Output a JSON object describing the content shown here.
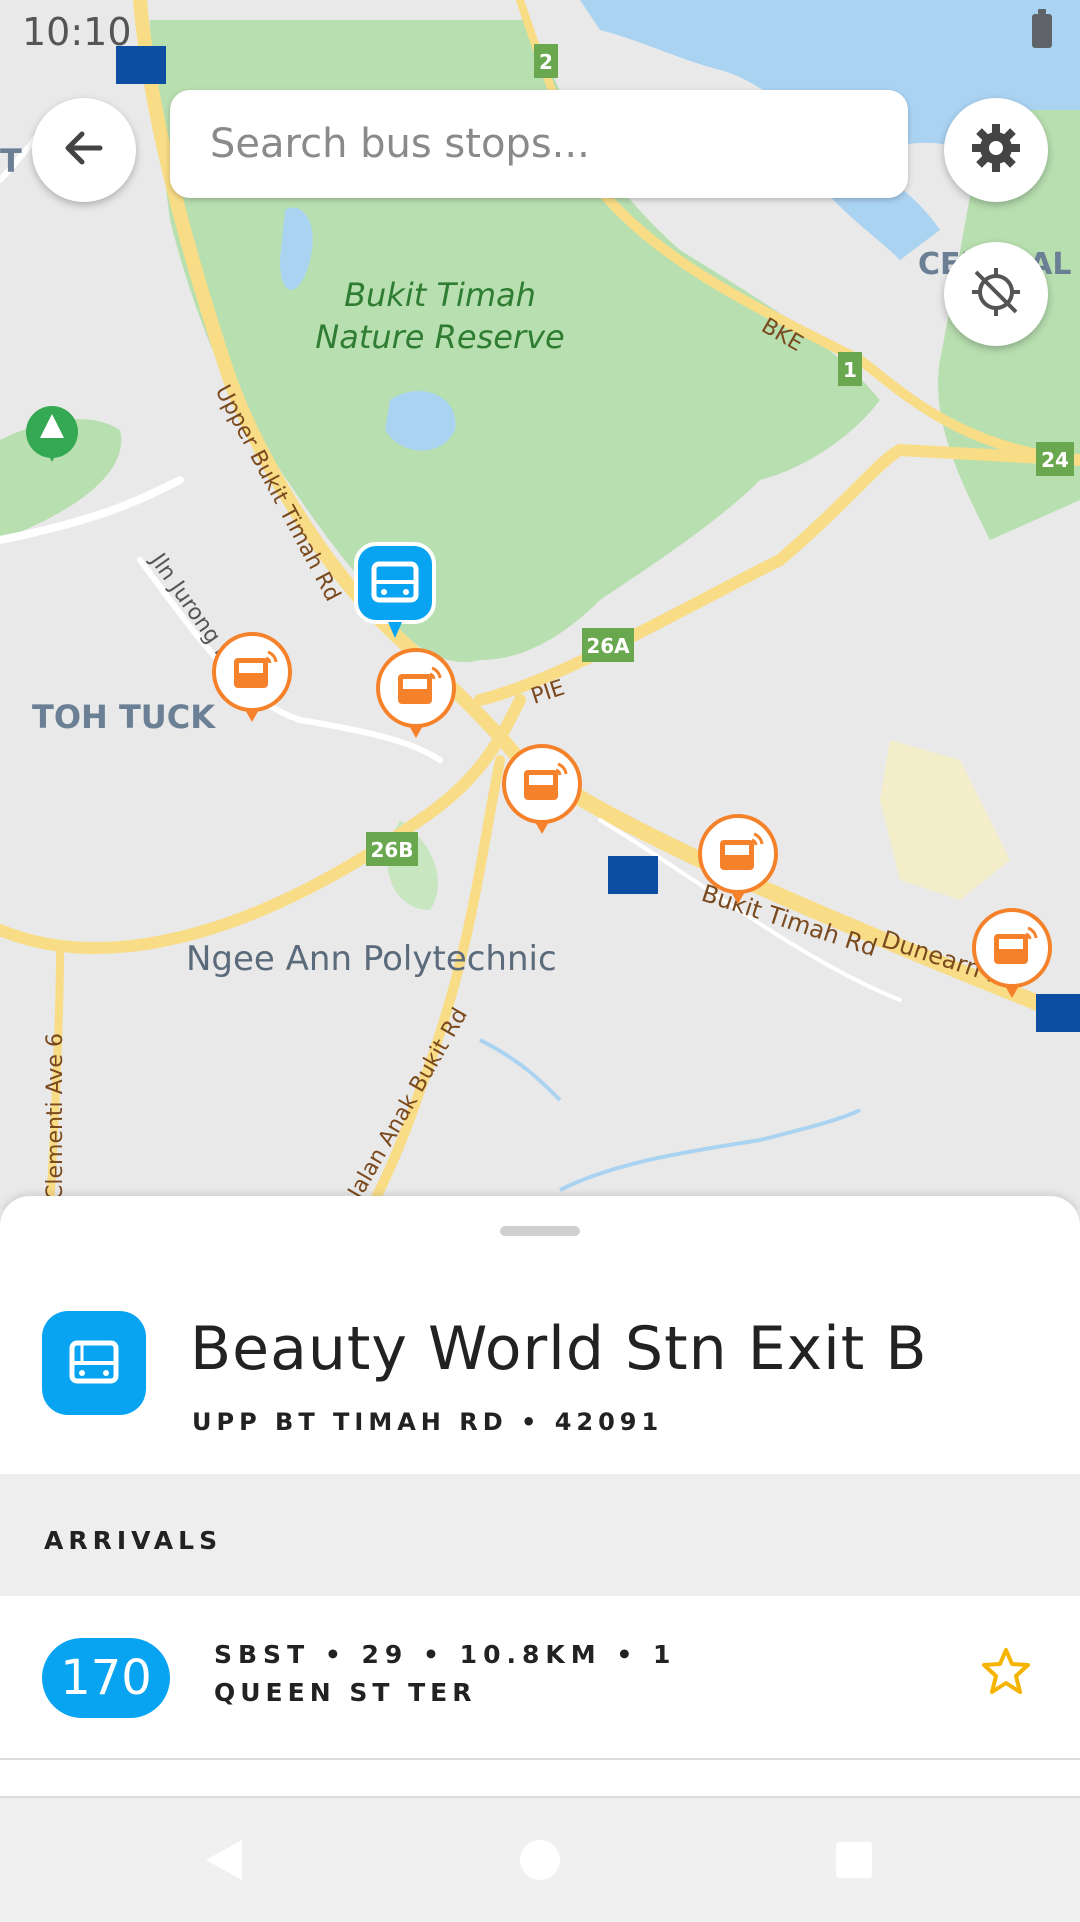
{
  "status_bar": {
    "time": "10:10"
  },
  "search": {
    "placeholder": "Search bus stops..."
  },
  "map_labels": {
    "park": "Bukit Timah Nature Reserve",
    "park_line1": "Bukit Timah",
    "park_line2": "Nature Reserve",
    "area_toh_tuck": "TOH TUCK",
    "area_ngee_ann": "Ngee Ann Polytechnic",
    "area_central": "CENTRAL",
    "area_left": "T",
    "road_upper_bukit_timah": "Upper Bukit Timah Rd",
    "road_jln_jurong": "Jln Jurong Kechil",
    "road_bukit_timah": "Bukit Timah Rd",
    "road_dunearn": "Dunearn Rd",
    "road_pie": "PIE",
    "road_bke": "BKE",
    "road_clementi": "Clementi Ave 6",
    "road_bottom": "Jalan Anak Bukit Rd",
    "exits": [
      "2",
      "1",
      "24",
      "26A",
      "26B"
    ]
  },
  "stop": {
    "name": "Beauty World Stn Exit B",
    "road": "UPP BT TIMAH RD",
    "code": "42091",
    "subtitle": "UPP BT TIMAH RD • 42091"
  },
  "arrivals": {
    "title": "ARRIVALS",
    "items": [
      {
        "route": "170",
        "operator": "SBST",
        "line1": "SBST  •  29  •  10.8KM  •  1",
        "destination": "QUEEN ST TER",
        "favorite": false
      }
    ]
  },
  "colors": {
    "accent": "#08a4f2",
    "bus_stop_marker": "#f5822a",
    "star": "#f5b400",
    "park": "#b8dfb0",
    "road": "#f9dc86",
    "water": "#aad3f2"
  },
  "icons": {
    "back": "arrow-left-icon",
    "settings": "gear-icon",
    "location": "location-disabled-icon",
    "stop": "bus-stop-icon",
    "favorite": "star-outline-icon"
  }
}
